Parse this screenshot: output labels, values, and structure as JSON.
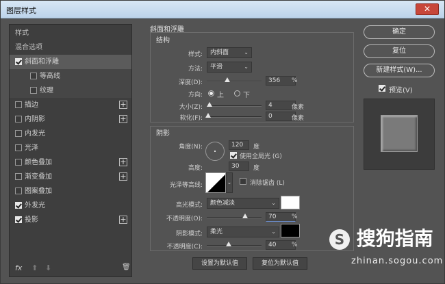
{
  "window": {
    "title": "图层样式",
    "close_glyph": "✕"
  },
  "left_panel": {
    "items": [
      {
        "label": "样式",
        "checkbox": false,
        "checked": false,
        "plus": false,
        "kind": "plain"
      },
      {
        "label": "混合选项",
        "checkbox": false,
        "checked": false,
        "plus": false,
        "kind": "plain"
      },
      {
        "label": "斜面和浮雕",
        "checkbox": true,
        "checked": true,
        "plus": false,
        "kind": "active"
      },
      {
        "label": "等高线",
        "checkbox": true,
        "checked": false,
        "plus": false,
        "kind": "sub"
      },
      {
        "label": "纹理",
        "checkbox": true,
        "checked": false,
        "plus": false,
        "kind": "sub"
      },
      {
        "label": "描边",
        "checkbox": true,
        "checked": false,
        "plus": true,
        "kind": "normal"
      },
      {
        "label": "内阴影",
        "checkbox": true,
        "checked": false,
        "plus": true,
        "kind": "normal"
      },
      {
        "label": "内发光",
        "checkbox": true,
        "checked": false,
        "plus": false,
        "kind": "normal"
      },
      {
        "label": "光泽",
        "checkbox": true,
        "checked": false,
        "plus": false,
        "kind": "normal"
      },
      {
        "label": "颜色叠加",
        "checkbox": true,
        "checked": false,
        "plus": true,
        "kind": "normal"
      },
      {
        "label": "渐变叠加",
        "checkbox": true,
        "checked": false,
        "plus": true,
        "kind": "normal"
      },
      {
        "label": "图案叠加",
        "checkbox": true,
        "checked": false,
        "plus": false,
        "kind": "normal"
      },
      {
        "label": "外发光",
        "checkbox": true,
        "checked": true,
        "plus": false,
        "kind": "normal"
      },
      {
        "label": "投影",
        "checkbox": true,
        "checked": true,
        "plus": true,
        "kind": "normal"
      }
    ],
    "footer": {
      "fx": "fx",
      "up": "⬆",
      "down": "⬇",
      "trash": "🗑"
    }
  },
  "bevel": {
    "section_title": "斜面和浮雕",
    "structure_title": "结构",
    "style_label": "样式:",
    "style_value": "内斜面",
    "method_label": "方法:",
    "method_value": "平滑",
    "depth_label": "深度(D):",
    "depth_value": "356",
    "depth_unit": "%",
    "direction_label": "方向:",
    "direction_up": "上",
    "direction_down": "下",
    "direction_selected": "上",
    "size_label": "大小(Z):",
    "size_value": "4",
    "size_unit": "像素",
    "soften_label": "软化(F):",
    "soften_value": "0",
    "soften_unit": "像素"
  },
  "shading": {
    "title": "阴影",
    "angle_label": "角度(N):",
    "angle_value": "120",
    "angle_unit": "度",
    "global_light_label": "使用全局光 (G)",
    "global_light_checked": true,
    "altitude_label": "高度:",
    "altitude_value": "30",
    "altitude_unit": "度",
    "gloss_contour_label": "光泽等高线:",
    "anti_alias_label": "消除锯齿 (L)",
    "anti_alias_checked": false,
    "highlight_mode_label": "高光模式:",
    "highlight_mode_value": "颜色减淡",
    "highlight_color": "#ffffff",
    "highlight_opacity_label": "不透明度(O):",
    "highlight_opacity_value": "70",
    "highlight_opacity_unit": "%",
    "shadow_mode_label": "阴影模式:",
    "shadow_mode_value": "柔光",
    "shadow_color": "#000000",
    "shadow_opacity_label": "不透明度(C):",
    "shadow_opacity_value": "40",
    "shadow_opacity_unit": "%"
  },
  "bottom_buttons": {
    "make_default": "设置为默认值",
    "reset_default": "复位为默认值"
  },
  "right_buttons": {
    "ok": "确定",
    "reset": "复位",
    "new_style": "新建样式(W)...",
    "preview_label": "预览(V)",
    "preview_checked": true
  },
  "watermark": {
    "logo": "搜狗指南",
    "url": "zhinan.sogou.com"
  }
}
